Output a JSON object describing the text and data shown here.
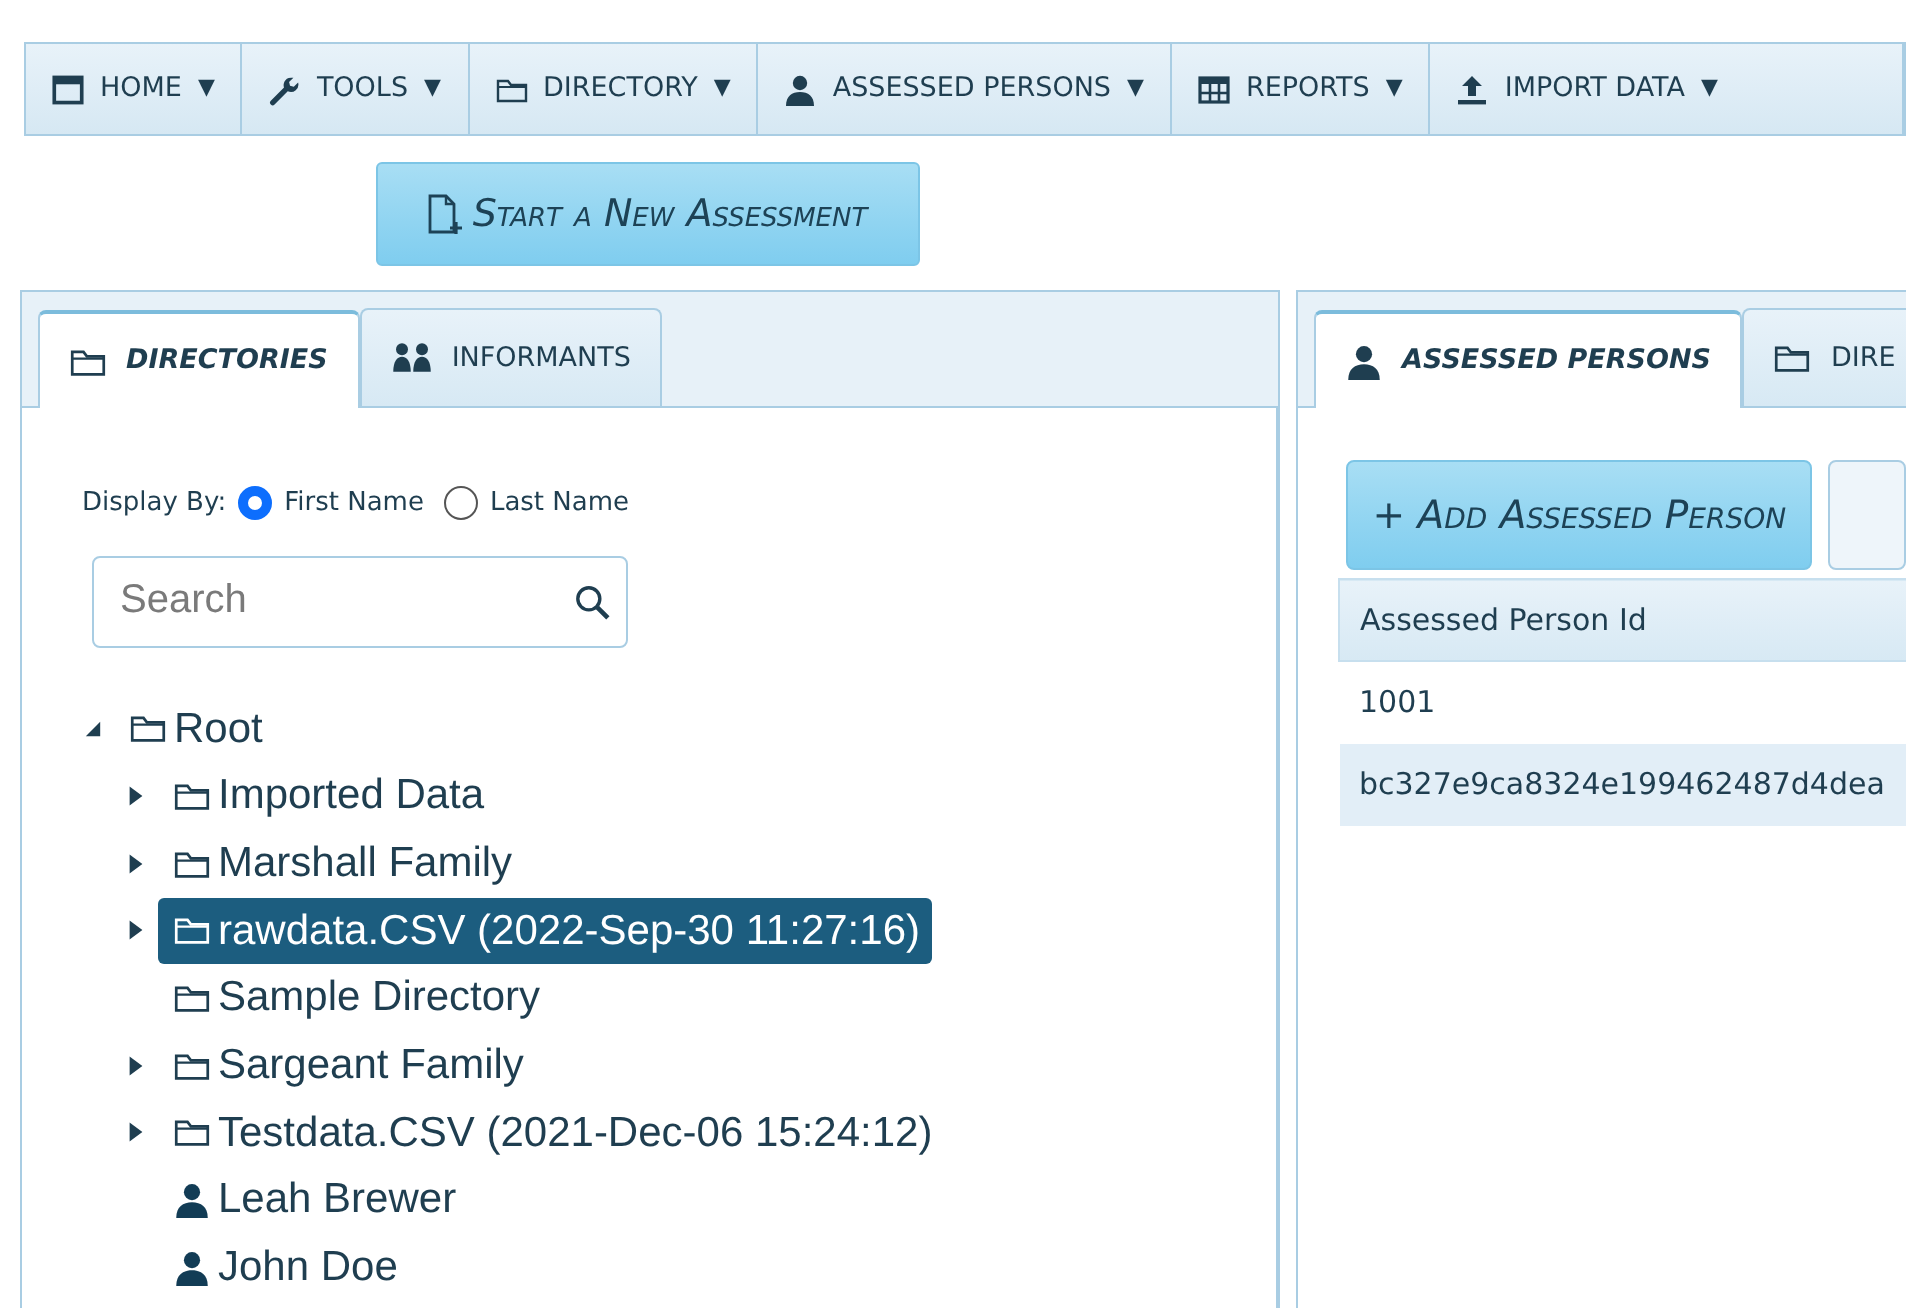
{
  "menu": [
    {
      "label": "HOME",
      "caret": "▼"
    },
    {
      "label": "TOOLS",
      "caret": "▼"
    },
    {
      "label": "DIRECTORY",
      "caret": "▼"
    },
    {
      "label": "ASSESSED PERSONS",
      "caret": "▼"
    },
    {
      "label": "REPORTS",
      "caret": "▼"
    },
    {
      "label": "IMPORT DATA",
      "caret": "▼"
    }
  ],
  "start_button": {
    "label": "Start a New Assessment"
  },
  "left_panel": {
    "tabs": [
      {
        "label": "DIRECTORIES",
        "selected": true
      },
      {
        "label": "INFORMANTS",
        "selected": false
      }
    ],
    "display_by": {
      "label": "Display By:",
      "options": [
        {
          "label": "First Name",
          "selected": true
        },
        {
          "label": "Last Name",
          "selected": false
        }
      ]
    },
    "search": {
      "placeholder": "Search"
    },
    "tree": [
      {
        "kind": "folder",
        "label": "Root",
        "expanded": true,
        "selected": false,
        "children": [
          {
            "kind": "folder",
            "label": "Imported Data",
            "expanded": false,
            "selected": false
          },
          {
            "kind": "folder",
            "label": "Marshall Family",
            "expanded": false,
            "selected": false
          },
          {
            "kind": "folder",
            "label": "rawdata.CSV (2022-Sep-30 11:27:16)",
            "expanded": false,
            "selected": true
          },
          {
            "kind": "empty_folder",
            "label": "Sample Directory",
            "expanded": false,
            "selected": false
          },
          {
            "kind": "folder",
            "label": "Sargeant Family",
            "expanded": false,
            "selected": false
          },
          {
            "kind": "folder",
            "label": "Testdata.CSV (2021-Dec-06 15:24:12)",
            "expanded": false,
            "selected": false
          },
          {
            "kind": "person",
            "label": "Leah Brewer",
            "expanded": false,
            "selected": false
          },
          {
            "kind": "person",
            "label": "John Doe",
            "expanded": false,
            "selected": false
          }
        ]
      }
    ]
  },
  "right_panel": {
    "tabs": [
      {
        "label": "ASSESSED PERSONS",
        "selected": true
      },
      {
        "label": "DIRE",
        "selected": false
      }
    ],
    "add_button": {
      "label": "+ Add Assessed Person"
    },
    "table": {
      "columns": [
        "Assessed Person Id"
      ],
      "rows": [
        [
          "1001"
        ],
        [
          "bc327e9ca8324e199462487d4dea"
        ]
      ]
    }
  }
}
